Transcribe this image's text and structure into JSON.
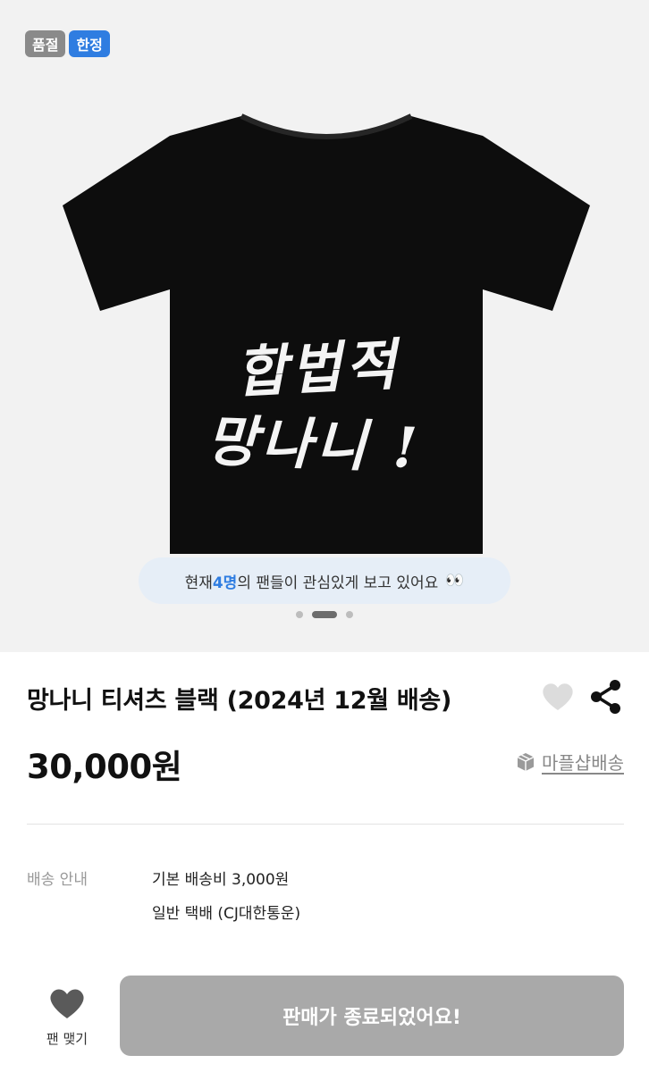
{
  "badges": {
    "soldout": "품절",
    "limited": "한정"
  },
  "product_image": {
    "print_line1": "합법적",
    "print_line2": "망나니 !",
    "viewer_prefix": "현재 ",
    "viewer_count": "4명",
    "viewer_suffix": "의 팬들이 관심있게 보고 있어요",
    "viewer_emoji": "👀",
    "carousel_total": 3,
    "carousel_active": 2
  },
  "product": {
    "title": "망나니 티셔츠 블랙 (2024년 12월 배송)",
    "price": "30,000원",
    "shipping_link": "마플샵배송"
  },
  "shipping_info": {
    "label": "배송 안내",
    "line1": "기본 배송비 3,000원",
    "line2": "일반 택배 (CJ대한통운)"
  },
  "bottom_bar": {
    "fan_label": "팬 맺기",
    "sold_out_button": "판매가 종료되었어요!"
  },
  "colors": {
    "accent_blue": "#2f7de1",
    "badge_gray": "#8a8a8a",
    "disabled_button": "#a9a9a9",
    "hero_bg": "#f2f2f2",
    "pill_bg": "#e6eef7"
  }
}
